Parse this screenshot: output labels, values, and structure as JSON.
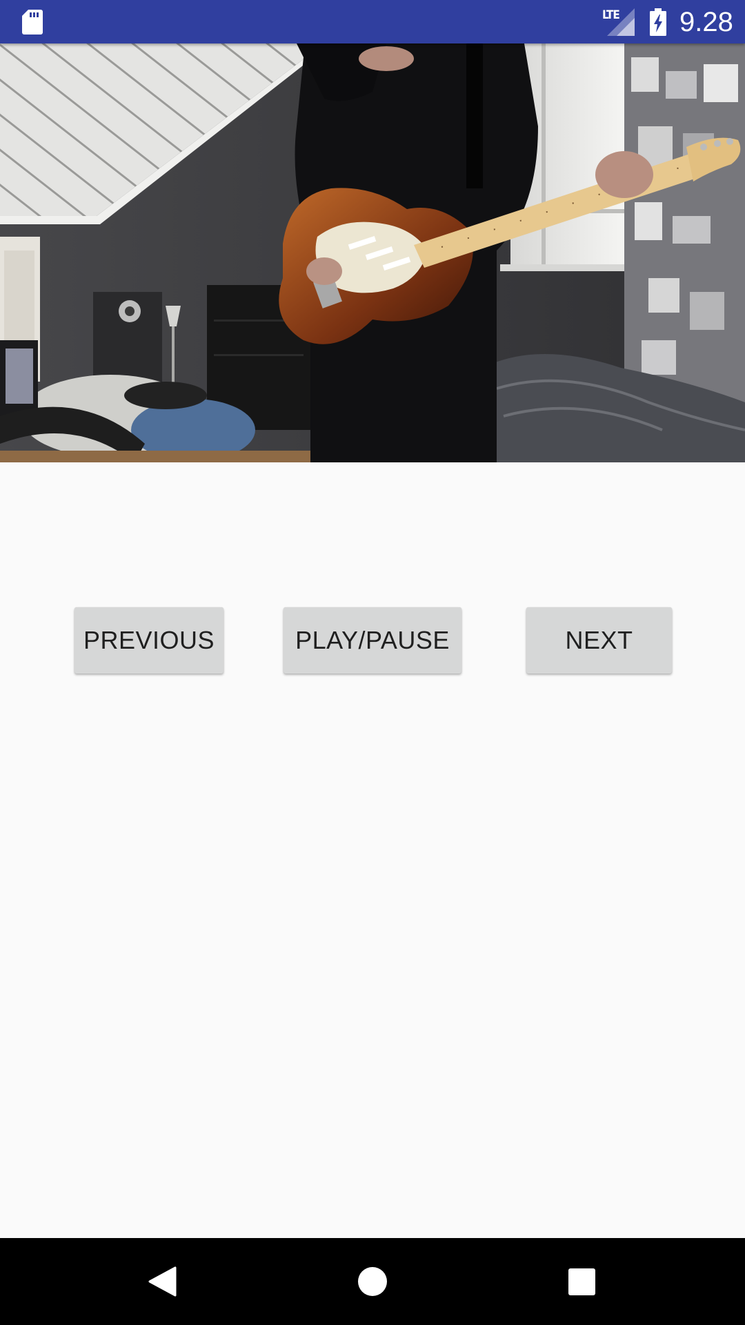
{
  "status_bar": {
    "network_type": "LTE",
    "time": "9.28",
    "color": "#303f9f",
    "icons": [
      "sd-card-icon",
      "signal-icon",
      "battery-charging-icon"
    ]
  },
  "video": {
    "description_icon": "video-frame"
  },
  "controls": {
    "previous_label": "PREVIOUS",
    "play_pause_label": "PLAY/PAUSE",
    "next_label": "NEXT"
  },
  "nav_bar": {
    "icons": [
      "back-icon",
      "home-icon",
      "recents-icon"
    ]
  }
}
